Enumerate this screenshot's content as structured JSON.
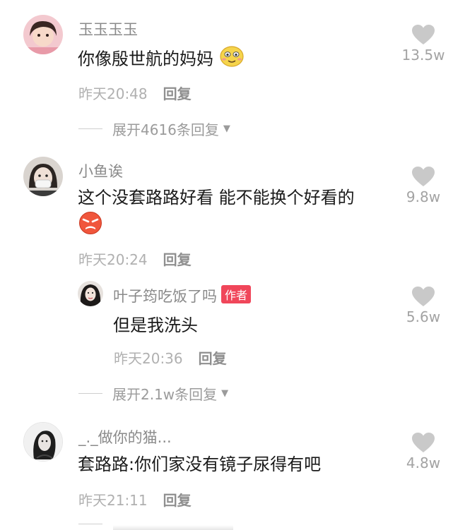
{
  "comments": [
    {
      "username": "玉玉玉玉",
      "text": "你像殷世航的妈妈",
      "time": "昨天20:48",
      "reply_label": "回复",
      "likes": "13.5w",
      "expand_label": "展开4616条回复"
    },
    {
      "username": "小鱼诶",
      "text": "这个没套路路好看 能不能换个好看的",
      "time": "昨天20:24",
      "reply_label": "回复",
      "likes": "9.8w",
      "sub_reply": {
        "username": "叶子筠吃饭了吗",
        "badge": "作者",
        "text": "但是我洗头",
        "time": "昨天20:36",
        "reply_label": "回复",
        "likes": "5.6w"
      },
      "expand_label": "展开2.1w条回复"
    },
    {
      "username": "_._做你的猫...",
      "text": "套路路:你们家没有镜子尿得有吧",
      "time": "昨天21:11",
      "reply_label": "回复",
      "likes": "4.8w"
    }
  ],
  "colors": {
    "username": "#8a8a8a",
    "content": "#1a1a1a",
    "time": "#b0b0b0",
    "heart": "#c9c9c9",
    "author_badge": "#f0465a"
  }
}
